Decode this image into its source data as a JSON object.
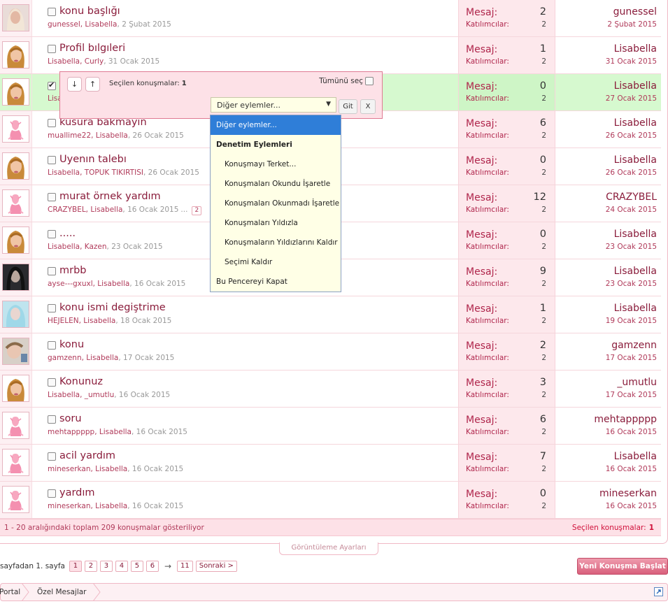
{
  "rows": [
    {
      "title": "konu başlığı",
      "parts": "gunessel, Lisabella",
      "date": "2 Şubat 2015",
      "more": "",
      "pagebox": "",
      "msg_label": "Mesaj:",
      "msg": "2",
      "part_label": "Katılımcılar:",
      "part": "2",
      "last_user": "gunessel",
      "last_date": "2 Şubat 2015",
      "avatar": "blonde-avatar",
      "checked": false
    },
    {
      "title": "Profil bılgıleri",
      "parts": "Lisabella, Curly",
      "date": "31 Ocak 2015",
      "more": "",
      "pagebox": "",
      "msg_label": "Mesaj:",
      "msg": "1",
      "part_label": "Katılımcılar:",
      "part": "2",
      "last_user": "Lisabella",
      "last_date": "31 Ocak 2015",
      "avatar": "lisabella-avatar",
      "checked": false
    },
    {
      "title": "",
      "parts": "Lisa",
      "date": "",
      "more": "",
      "pagebox": "",
      "msg_label": "Mesaj:",
      "msg": "0",
      "part_label": "Katılımcılar:",
      "part": "2",
      "last_user": "Lisabella",
      "last_date": "27 Ocak 2015",
      "avatar": "lisabella-avatar",
      "checked": true
    },
    {
      "title": "kusura bakmayin",
      "parts": "muallime22, Lisabella",
      "date": "26 Ocak 2015",
      "more": "",
      "pagebox": "",
      "msg_label": "Mesaj:",
      "msg": "6",
      "part_label": "Katılımcılar:",
      "part": "2",
      "last_user": "Lisabella",
      "last_date": "26 Ocak 2015",
      "avatar": "default-avatar",
      "checked": false
    },
    {
      "title": "Uyenın talebı",
      "parts": "Lisabella, TOPUK TIKIRTISI",
      "date": "26 Ocak 2015",
      "more": "",
      "pagebox": "",
      "msg_label": "Mesaj:",
      "msg": "0",
      "part_label": "Katılımcılar:",
      "part": "2",
      "last_user": "Lisabella",
      "last_date": "26 Ocak 2015",
      "avatar": "lisabella-avatar",
      "checked": false
    },
    {
      "title": "murat örnek yardım",
      "parts": "CRAZYBEL, Lisabella",
      "date": "16 Ocak 2015",
      "more": "...",
      "pagebox": "2",
      "msg_label": "Mesaj:",
      "msg": "12",
      "part_label": "Katılımcılar:",
      "part": "2",
      "last_user": "CRAZYBEL",
      "last_date": "24 Ocak 2015",
      "avatar": "default-avatar",
      "checked": false
    },
    {
      "title": ".....",
      "parts": "Lisabella, Kazen",
      "date": "23 Ocak 2015",
      "more": "",
      "pagebox": "",
      "msg_label": "Mesaj:",
      "msg": "0",
      "part_label": "Katılımcılar:",
      "part": "2",
      "last_user": "Lisabella",
      "last_date": "23 Ocak 2015",
      "avatar": "lisabella-avatar",
      "checked": false
    },
    {
      "title": "mrbb",
      "parts": "ayse---gxuxl, Lisabella",
      "date": "16 Ocak 2015",
      "more": "",
      "pagebox": "",
      "msg_label": "Mesaj:",
      "msg": "9",
      "part_label": "Katılımcılar:",
      "part": "2",
      "last_user": "Lisabella",
      "last_date": "23 Ocak 2015",
      "avatar": "dark-avatar",
      "checked": false
    },
    {
      "title": "konu ismi degiştrime",
      "parts": "HEJELEN, Lisabella",
      "date": "18 Ocak 2015",
      "more": "",
      "pagebox": "",
      "msg_label": "Mesaj:",
      "msg": "1",
      "part_label": "Katılımcılar:",
      "part": "2",
      "last_user": "Lisabella",
      "last_date": "19 Ocak 2015",
      "avatar": "blue-avatar",
      "checked": false
    },
    {
      "title": "konu",
      "parts": "gamzenn, Lisabella",
      "date": "17 Ocak 2015",
      "more": "",
      "pagebox": "",
      "msg_label": "Mesaj:",
      "msg": "2",
      "part_label": "Katılımcılar:",
      "part": "2",
      "last_user": "gamzenn",
      "last_date": "17 Ocak 2015",
      "avatar": "child-avatar",
      "checked": false
    },
    {
      "title": "Konunuz",
      "parts": "Lisabella, _umutlu",
      "date": "16 Ocak 2015",
      "more": "",
      "pagebox": "",
      "msg_label": "Mesaj:",
      "msg": "3",
      "part_label": "Katılımcılar:",
      "part": "2",
      "last_user": "_umutlu",
      "last_date": "17 Ocak 2015",
      "avatar": "lisabella-avatar",
      "checked": false
    },
    {
      "title": "soru",
      "parts": "mehtappppp, Lisabella",
      "date": "16 Ocak 2015",
      "more": "",
      "pagebox": "",
      "msg_label": "Mesaj:",
      "msg": "6",
      "part_label": "Katılımcılar:",
      "part": "2",
      "last_user": "mehtappppp",
      "last_date": "16 Ocak 2015",
      "avatar": "default-avatar",
      "checked": false
    },
    {
      "title": "acil yardım",
      "parts": "mineserkan, Lisabella",
      "date": "16 Ocak 2015",
      "more": "",
      "pagebox": "",
      "msg_label": "Mesaj:",
      "msg": "7",
      "part_label": "Katılımcılar:",
      "part": "2",
      "last_user": "Lisabella",
      "last_date": "16 Ocak 2015",
      "avatar": "default-avatar",
      "checked": false
    },
    {
      "title": "yardım",
      "parts": "mineserkan, Lisabella",
      "date": "16 Ocak 2015",
      "more": "",
      "pagebox": "",
      "msg_label": "Mesaj:",
      "msg": "0",
      "part_label": "Katılımcılar:",
      "part": "2",
      "last_user": "mineserkan",
      "last_date": "16 Ocak 2015",
      "avatar": "default-avatar",
      "checked": false
    }
  ],
  "footer": {
    "summary": "1 - 20 aralığındaki toplam 209 konuşmalar gösteriliyor",
    "selected_label": "Seçilen konuşmalar:",
    "selected_count": "1"
  },
  "view_settings": "Görüntüleme Ayarları",
  "pager": {
    "label": "sayfadan 1. sayfa",
    "pages": [
      "1",
      "2",
      "3",
      "4",
      "5",
      "6"
    ],
    "last": "11",
    "next": "Sonraki >"
  },
  "new_conversation": "Yeni Konuşma Başlat",
  "breadcrumb": [
    "Portal",
    "Özel Mesajlar"
  ],
  "popup": {
    "down": "↓",
    "up": "↑",
    "selected_label": "Seçilen konuşmalar:",
    "selected_count": "1",
    "select_all": "Tümünü seç",
    "select_value": "Diğer eylemler...",
    "go": "Git",
    "close": "X"
  },
  "dropdown": [
    {
      "label": "Diğer eylemler...",
      "kind": "hl"
    },
    {
      "label": "Denetim Eylemleri",
      "kind": "grp"
    },
    {
      "label": "Konuşmayı Terket...",
      "kind": "sub"
    },
    {
      "label": "Konuşmaları Okundu İşaretle",
      "kind": "sub"
    },
    {
      "label": "Konuşmaları Okunmadı İşaretle",
      "kind": "sub"
    },
    {
      "label": "Konuşmaları Yıldızla",
      "kind": "sub"
    },
    {
      "label": "Konuşmaların Yıldızlarını Kaldır",
      "kind": "sub"
    },
    {
      "label": "Seçimi Kaldır",
      "kind": "sub"
    },
    {
      "label": "Bu Pencereyi Kapat",
      "kind": ""
    }
  ],
  "colors": {
    "accent": "#8a1c3b",
    "row_selected": "#d6f9cf",
    "stats_bg": "#fde8ec",
    "dropdown_highlight": "#2f7ed8"
  }
}
